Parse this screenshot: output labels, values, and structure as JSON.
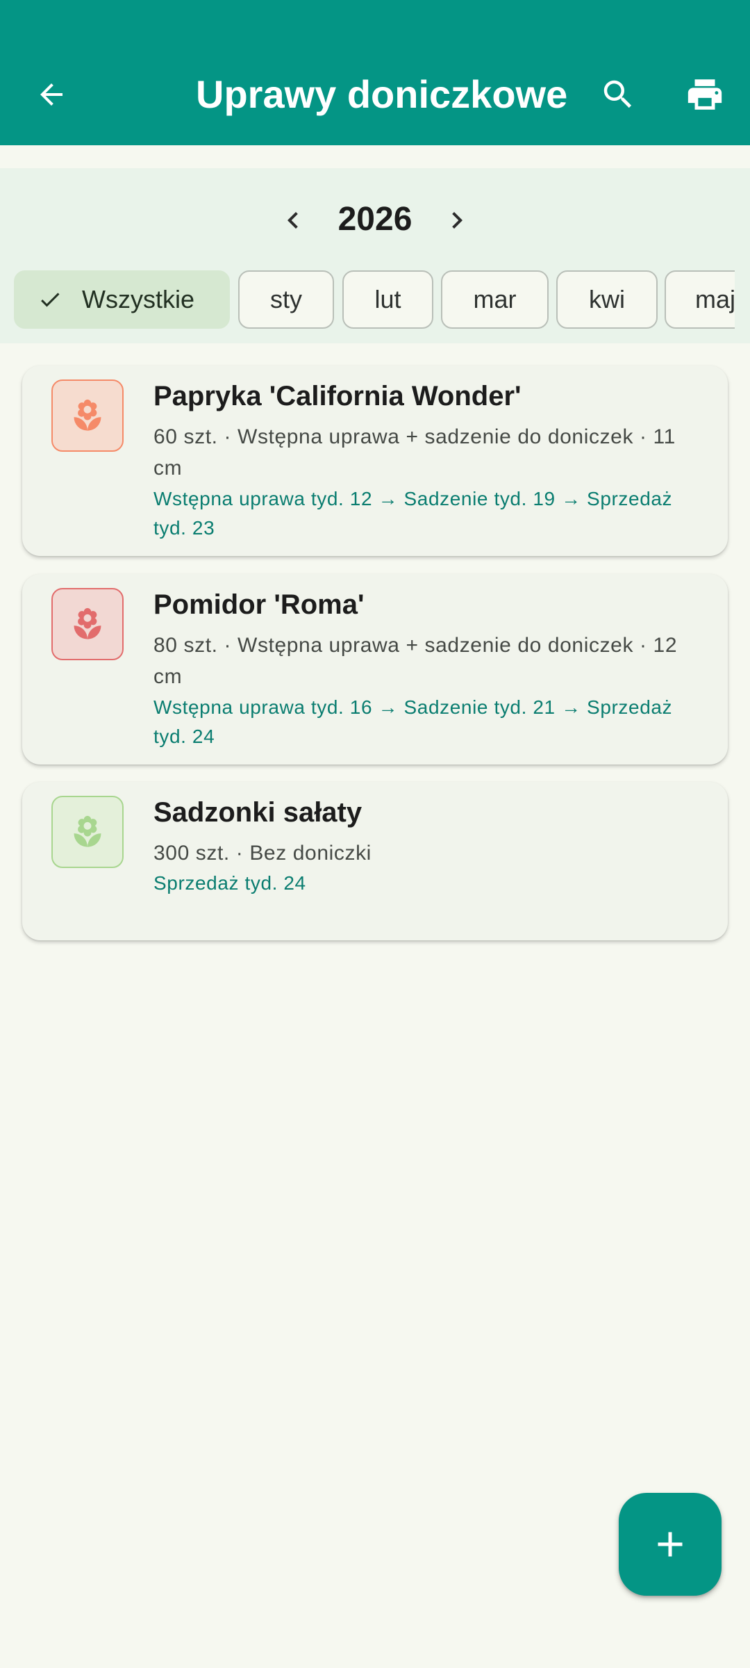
{
  "app_bar": {
    "title": "Uprawy doniczkowe",
    "back_icon": "arrow-back-icon",
    "search_icon": "search-icon",
    "print_icon": "print-icon",
    "color": "#049585"
  },
  "year_selector": {
    "year": "2026",
    "prev_icon": "chevron-left-icon",
    "next_icon": "chevron-right-icon"
  },
  "month_filters": [
    {
      "label": "Wszystkie",
      "selected": true,
      "icon": "check-icon"
    },
    {
      "label": "sty",
      "selected": false
    },
    {
      "label": "lut",
      "selected": false
    },
    {
      "label": "mar",
      "selected": false
    },
    {
      "label": "kwi",
      "selected": false
    },
    {
      "label": "maj",
      "selected": false
    }
  ],
  "crops": [
    {
      "name": "Papryka 'California Wonder'",
      "details": "60 szt. · Wstępna uprawa + sadzenie do doniczek · 11 cm",
      "schedule": "Wstępna uprawa tyd. 12 → Sadzenie tyd. 19 → Sprzedaż tyd. 23",
      "icon": "flower-icon",
      "icon_color": "#f58a68",
      "icon_bg": "#f6dccf"
    },
    {
      "name": "Pomidor 'Roma'",
      "details": "80 szt. · Wstępna uprawa + sadzenie do doniczek · 12 cm",
      "schedule": "Wstępna uprawa tyd. 16 → Sadzenie tyd. 21 → Sprzedaż tyd. 24",
      "icon": "flower-icon",
      "icon_color": "#e26c6c",
      "icon_bg": "#f2d8d3"
    },
    {
      "name": "Sadzonki sałaty",
      "details": "300 szt. · Bez doniczki",
      "schedule": "Sprzedaż tyd. 24",
      "icon": "flower-icon",
      "icon_color": "#a8d68f",
      "icon_bg": "#e4f0da"
    }
  ],
  "fab": {
    "icon": "plus-icon"
  }
}
